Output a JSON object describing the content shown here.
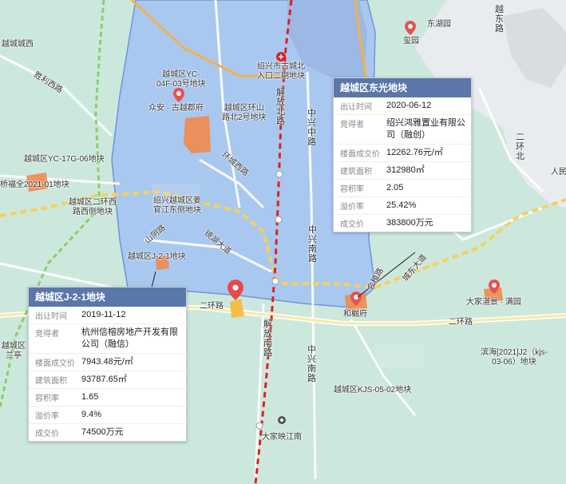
{
  "labels": {
    "yuecheng_west": "越城城西",
    "shengli_west_road": "胜利西路",
    "yc04f03": "越城区YC-\n04F-03号地块",
    "zhongan": "众安 · 古越郡府",
    "huanshan_north2": "越城区环山\n路北2号地块",
    "yc17g06": "越城区YC-17G-06地块",
    "qiaofuquan": "桥福全2021-01地块",
    "erhuan_west": "越城区二环西\n路西侧地块",
    "jiangong": "绍兴越城区姜\n官江东侧地块",
    "huancheng_west": "环城西路",
    "shanyin_road": "山阴路",
    "j21": "越城区J-2-1地块",
    "jinghu_road": "镜湖大道",
    "gucheng_north": "绍兴市古城北\n入口二期地块",
    "xiyuan": "玺园",
    "dongfangyun": "东湖园",
    "jiefang_north": "解放北路",
    "zhongxing_mid": "中兴中路",
    "zhongxing_south": "中兴南路",
    "zhongxing_south2": "中兴南路",
    "jiefang_south": "解放南路",
    "huimin": "和樾府",
    "dajia": "大家湛景 · 满园",
    "binhai": "滨海[2021]J2（kjs-\n03-06）地块",
    "kjs0502": "越城区KJS-05-02地块",
    "dajia_yingjiang": "大家映江南",
    "erhuan_north": "二环北",
    "erhuan_road": "二环路",
    "yuedong_road": "越东路",
    "renmin": "人民",
    "huiji_road": "会稽路",
    "chengdong": "城东大道",
    "erhuan_road2": "二环路",
    "yunlan": "越城区\n兰亭"
  },
  "cards": [
    {
      "title": "越城区东光地块",
      "rows": [
        {
          "k": "出让时间",
          "v": "2020-06-12"
        },
        {
          "k": "竞得者",
          "v": "绍兴鸿雅置业有限公司（融创）"
        },
        {
          "k": "楼面成交价",
          "v": "12262.76元/㎡"
        },
        {
          "k": "建筑面积",
          "v": "312980㎡"
        },
        {
          "k": "容积率",
          "v": "2.05"
        },
        {
          "k": "溢价率",
          "v": "25.42%"
        },
        {
          "k": "成交价",
          "v": "383800万元"
        }
      ]
    },
    {
      "title": "越城区J-2-1地块",
      "rows": [
        {
          "k": "出让时间",
          "v": "2019-11-12"
        },
        {
          "k": "竞得者",
          "v": "杭州信榕房地产开发有限公司（融信）"
        },
        {
          "k": "楼面成交价",
          "v": "7943.48元/㎡"
        },
        {
          "k": "建筑面积",
          "v": "93787.65㎡"
        },
        {
          "k": "容积率",
          "v": "1.65"
        },
        {
          "k": "溢价率",
          "v": "9.4%"
        },
        {
          "k": "成交价",
          "v": "74500万元"
        }
      ]
    }
  ],
  "colors": {
    "district_fill": "#a9c8f0",
    "district_border": "#6f94d8",
    "metro": "#e02020",
    "ring_road": "#f5d15a",
    "pin": "#e95050",
    "card_header": "#5a77a8"
  }
}
